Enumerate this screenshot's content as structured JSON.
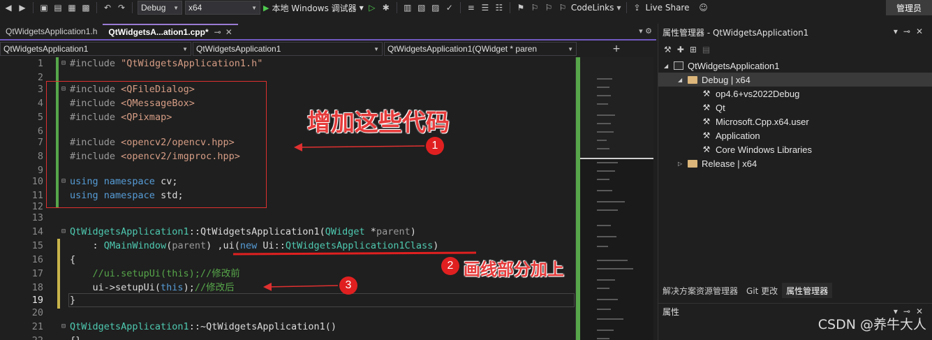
{
  "toolbar": {
    "config": "Debug",
    "platform": "x64",
    "run_label": "本地 Windows 调试器",
    "codelinks": "CodeLinks",
    "liveshare": "Live Share",
    "admin": "管理员"
  },
  "tabs": [
    {
      "label": "QtWidgetsApplication1.h",
      "active": false
    },
    {
      "label": "QtWidgetsA...ation1.cpp",
      "active": true,
      "modified": "*"
    }
  ],
  "navbar": {
    "project": "QtWidgetsApplication1",
    "scope": "QtWidgetsApplication1",
    "member": "QtWidgetsApplication1(QWidget * paren"
  },
  "code_lines": [
    {
      "n": "1",
      "text": "#include \"QtWidgetsApplication1.h\""
    },
    {
      "n": "2",
      "text": ""
    },
    {
      "n": "3",
      "text": "#include <QFileDialog>"
    },
    {
      "n": "4",
      "text": "#include <QMessageBox>"
    },
    {
      "n": "5",
      "text": "#include <QPixmap>"
    },
    {
      "n": "6",
      "text": ""
    },
    {
      "n": "7",
      "text": "#include <opencv2/opencv.hpp>"
    },
    {
      "n": "8",
      "text": "#include <opencv2/imgproc.hpp>"
    },
    {
      "n": "9",
      "text": ""
    },
    {
      "n": "10",
      "text": "using namespace cv;"
    },
    {
      "n": "11",
      "text": "using namespace std;"
    },
    {
      "n": "12",
      "text": ""
    },
    {
      "n": "13",
      "text": ""
    },
    {
      "n": "14",
      "text": "QtWidgetsApplication1::QtWidgetsApplication1(QWidget *parent)"
    },
    {
      "n": "15",
      "text": "    : QMainWindow(parent) ,ui(new Ui::QtWidgetsApplication1Class)"
    },
    {
      "n": "16",
      "text": "{"
    },
    {
      "n": "17",
      "text": "    //ui.setupUi(this);//修改前"
    },
    {
      "n": "18",
      "text": "    ui->setupUi(this);//修改后"
    },
    {
      "n": "19",
      "text": "}"
    },
    {
      "n": "20",
      "text": ""
    },
    {
      "n": "21",
      "text": "QtWidgetsApplication1::~QtWidgetsApplication1()"
    },
    {
      "n": "22",
      "text": "{}"
    }
  ],
  "annotations": {
    "note1": "增加这些代码",
    "badge1": "1",
    "note2": "画线部分加上",
    "badge2": "2",
    "badge3": "3"
  },
  "property_manager": {
    "title": "属性管理器 - QtWidgetsApplication1",
    "tree": [
      {
        "label": "QtWidgetsApplication1",
        "level": 0,
        "icon": "project-icon",
        "expanded": true
      },
      {
        "label": "Debug | x64",
        "level": 1,
        "icon": "folder-icon",
        "expanded": true,
        "selected": true
      },
      {
        "label": "op4.6+vs2022Debug",
        "level": 2,
        "icon": "wrench-icon"
      },
      {
        "label": "Qt",
        "level": 2,
        "icon": "wrench-icon"
      },
      {
        "label": "Microsoft.Cpp.x64.user",
        "level": 2,
        "icon": "wrench-icon"
      },
      {
        "label": "Application",
        "level": 2,
        "icon": "wrench-icon"
      },
      {
        "label": "Core Windows Libraries",
        "level": 2,
        "icon": "wrench-icon"
      },
      {
        "label": "Release | x64",
        "level": 1,
        "icon": "folder-icon",
        "expanded": false
      }
    ],
    "bottom_tabs": [
      "解决方案资源管理器",
      "Git 更改",
      "属性管理器"
    ],
    "props_title": "属性"
  },
  "watermark": "CSDN @养牛大人"
}
